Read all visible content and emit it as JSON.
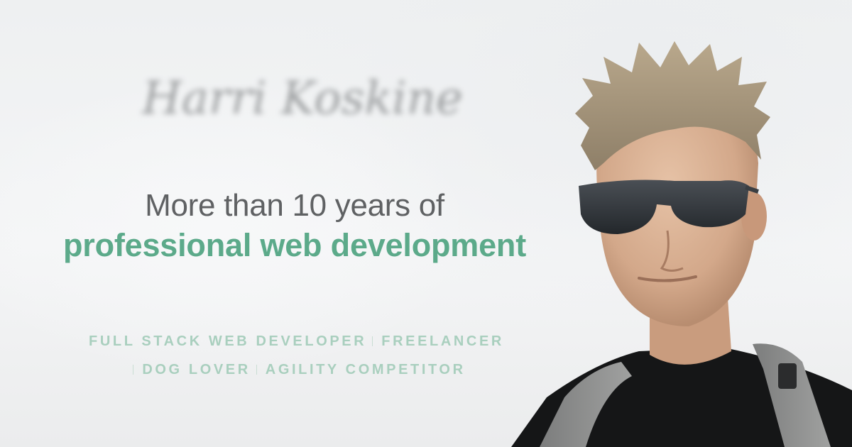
{
  "signature": {
    "text": "Harri Koskinen"
  },
  "headline": {
    "line1": "More than 10 years of",
    "line2": "professional web development"
  },
  "roles": [
    {
      "label": "FULL STACK WEB DEVELOPER"
    },
    {
      "label": "FREELANCER"
    },
    {
      "label": "DOG LOVER"
    },
    {
      "label": "AGILITY COMPETITOR"
    }
  ],
  "colors": {
    "accent": "#5caa8a",
    "roles": "#a9cfbe",
    "text": "#5f6163"
  }
}
